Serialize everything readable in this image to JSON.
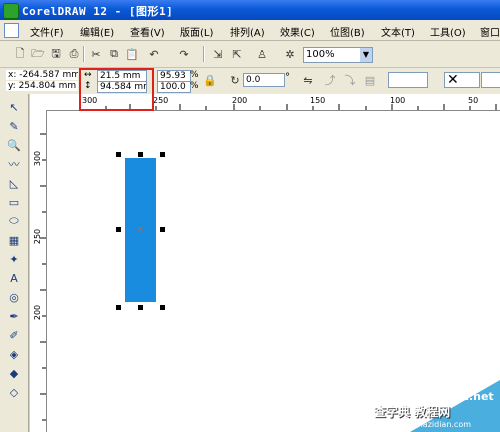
{
  "window": {
    "title": "CorelDRAW 12 - [图形1]"
  },
  "menu": [
    "文件(F)",
    "编辑(E)",
    "查看(V)",
    "版面(L)",
    "排列(A)",
    "效果(C)",
    "位图(B)",
    "文本(T)",
    "工具(O)",
    "窗口"
  ],
  "toolbar": {
    "zoom": "100%"
  },
  "propbar": {
    "x": "x: -264.587 mm",
    "y": "y: 254.804 mm",
    "width": "21.5 mm",
    "height": "94.584 mm",
    "scale_x": "95.93",
    "scale_y": "100.0",
    "percent": "%",
    "rotation": "0.0",
    "degree": "°"
  },
  "ruler": {
    "top": [
      "300",
      "250",
      "200",
      "150",
      "100",
      "50"
    ],
    "left": [
      "300",
      "250",
      "200"
    ]
  },
  "colors": {
    "rectangle": "#1a8ce0",
    "highlight": "#e0201a"
  },
  "watermark": {
    "site": "jb51.net",
    "brand": "查字典 教程网",
    "url": "jiaocheng.chazidian.com"
  }
}
